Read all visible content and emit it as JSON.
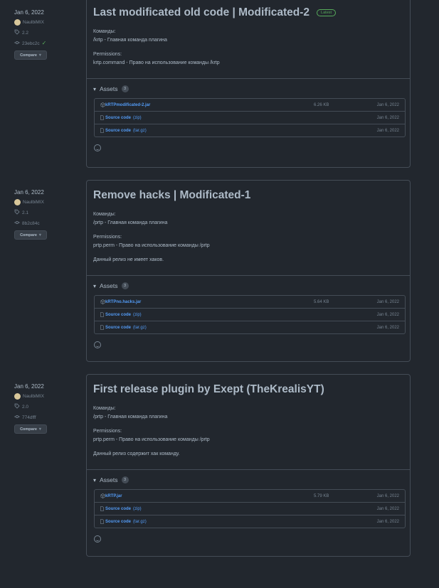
{
  "releases": [
    {
      "date": "Jan 6, 2022",
      "author": "NaulbiMIX",
      "tag": "2.2",
      "commit": "23ebc2c",
      "verified": true,
      "compare_label": "Compare",
      "title": "Last modificated old code | Modificated-2",
      "badge": "Latest",
      "commands_heading": "Команды:",
      "command_line": "/krtp - Главная команда плагина",
      "permissions_heading": "Permissions:",
      "permission_line": "krtp.command - Право на использование команды /krtp",
      "note": "",
      "assets_label": "Assets",
      "assets_count": "3",
      "assets": [
        {
          "name": "kRTPmodificated-2.jar",
          "suffix": "",
          "size": "6.26 KB",
          "date": "Jan 6, 2022"
        },
        {
          "name": "Source code",
          "suffix": "(zip)",
          "size": "",
          "date": "Jan 6, 2022"
        },
        {
          "name": "Source code",
          "suffix": "(tar.gz)",
          "size": "",
          "date": "Jan 6, 2022"
        }
      ]
    },
    {
      "date": "Jan 6, 2022",
      "author": "NaulbiMIX",
      "tag": "2.1",
      "commit": "8b2c84c",
      "verified": false,
      "compare_label": "Compare",
      "title": "Remove hacks | Modificated-1",
      "badge": "",
      "commands_heading": "Команды:",
      "command_line": "/prtp - Главная команда плагина",
      "permissions_heading": "Permissions:",
      "permission_line": "prtp.perm - Право на использование команды /prtp",
      "note": "Данный релиз не имеет хаков.",
      "assets_label": "Assets",
      "assets_count": "3",
      "assets": [
        {
          "name": "kRTPno.hacks.jar",
          "suffix": "",
          "size": "5.64 KB",
          "date": "Jan 6, 2022"
        },
        {
          "name": "Source code",
          "suffix": "(zip)",
          "size": "",
          "date": "Jan 6, 2022"
        },
        {
          "name": "Source code",
          "suffix": "(tar.gz)",
          "size": "",
          "date": "Jan 6, 2022"
        }
      ]
    },
    {
      "date": "Jan 6, 2022",
      "author": "NaulbiMIX",
      "tag": "2.0",
      "commit": "774dfff",
      "verified": false,
      "compare_label": "Compare",
      "title": "First release plugin by Exept (TheKrealisYT)",
      "badge": "",
      "commands_heading": "Команды:",
      "command_line": "/prtp - Главная команда плагина",
      "permissions_heading": "Permissions:",
      "permission_line": "prtp.perm - Право на использование команды /prtp",
      "note": "Данный релиз содержит хак команду.",
      "assets_label": "Assets",
      "assets_count": "3",
      "assets": [
        {
          "name": "kRTP.jar",
          "suffix": "",
          "size": "5.79 KB",
          "date": "Jan 6, 2022"
        },
        {
          "name": "Source code",
          "suffix": "(zip)",
          "size": "",
          "date": "Jan 6, 2022"
        },
        {
          "name": "Source code",
          "suffix": "(tar.gz)",
          "size": "",
          "date": "Jan 6, 2022"
        }
      ]
    }
  ]
}
